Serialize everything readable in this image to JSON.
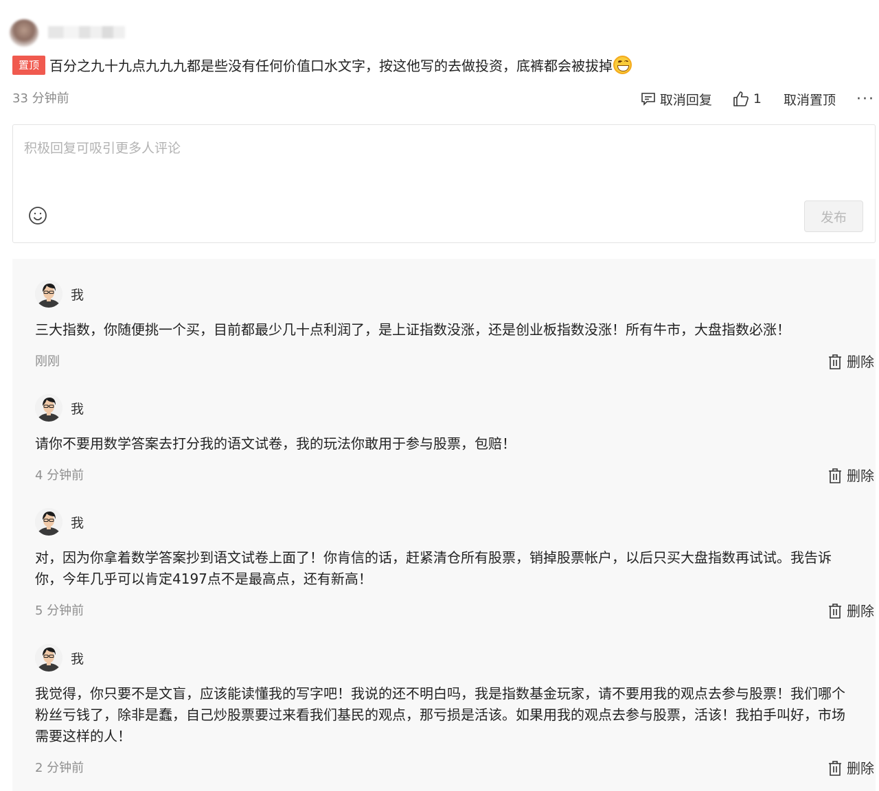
{
  "post": {
    "pin_badge": "置顶",
    "title": "百分之九十九点九九九都是些没有任何价值口水文字，按这他写的去做投资，底裤都会被拔掉",
    "emoji": "grinning-face",
    "time": "33 分钟前",
    "actions": {
      "cancel_reply": "取消回复",
      "like_count": "1",
      "unpin": "取消置顶",
      "more": "···"
    }
  },
  "reply_box": {
    "placeholder": "积极回复可吸引更多人评论",
    "value": "",
    "publish_label": "发布"
  },
  "replies": [
    {
      "name": "我",
      "text": "三大指数，你随便挑一个买，目前都最少几十点利润了，是上证指数没涨，还是创业板指数没涨！所有牛市，大盘指数必涨！",
      "time": "刚刚",
      "delete_label": "删除"
    },
    {
      "name": "我",
      "text": "请你不要用数学答案去打分我的语文试卷，我的玩法你敢用于参与股票，包赔！",
      "time": "4 分钟前",
      "delete_label": "删除"
    },
    {
      "name": "我",
      "text": "对，因为你拿着数学答案抄到语文试卷上面了！你肯信的话，赶紧清仓所有股票，销掉股票帐户，以后只买大盘指数再试试。我告诉你，今年几乎可以肯定4197点不是最高点，还有新高！",
      "time": "5 分钟前",
      "delete_label": "删除"
    },
    {
      "name": "我",
      "text": "我觉得，你只要不是文盲，应该能读懂我的写字吧！我说的还不明白吗，我是指数基金玩家，请不要用我的观点去参与股票！我们哪个粉丝亏钱了，除非是蠢，自己炒股票要过来看我们基民的观点，那亏损是活该。如果用我的观点去参与股票，活该！我拍手叫好，市场需要这样的人！",
      "time": "2 分钟前",
      "delete_label": "删除"
    }
  ]
}
